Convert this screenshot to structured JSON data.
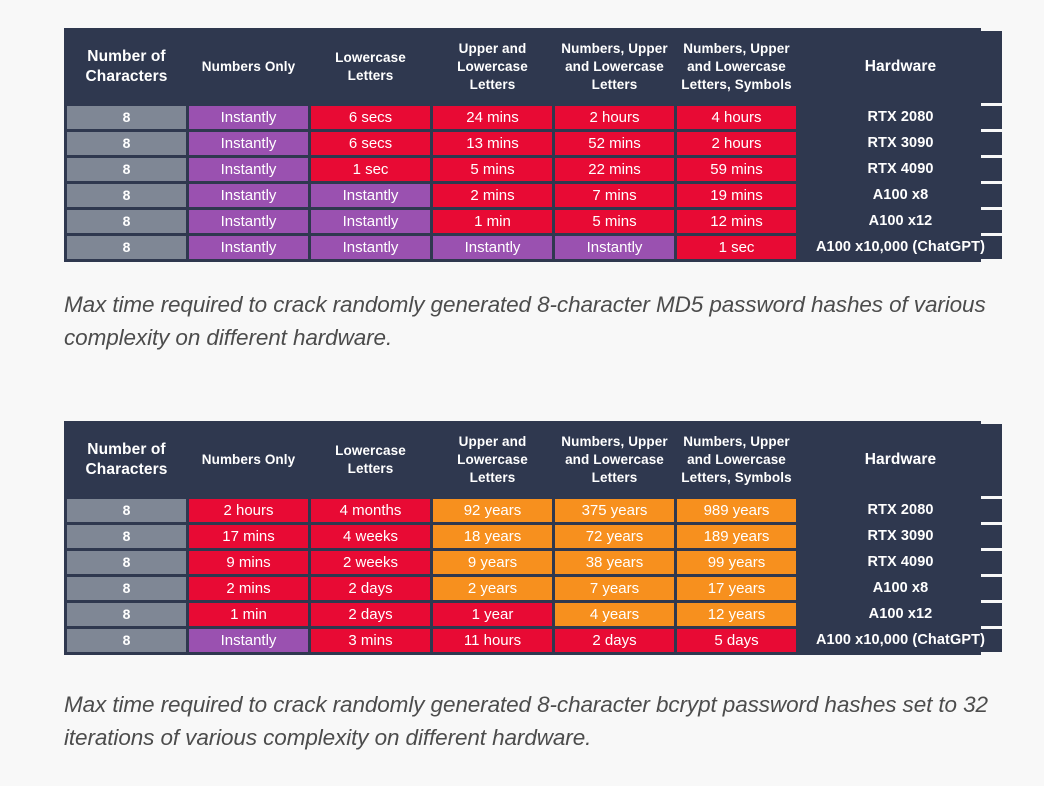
{
  "palette": {
    "page_background": "#f8f8f8",
    "table_background": "#2f384f",
    "gray": "#7f8795",
    "purple": "#9a51b0",
    "red": "#e80a34",
    "orange": "#f7901e",
    "text_light": "#ffffff",
    "caption_text": "#4c4c4c"
  },
  "tables": [
    {
      "id": "md5-table",
      "headers": [
        "Number of Characters",
        "Numbers Only",
        "Lowercase Letters",
        "Upper and Lowercase Letters",
        "Numbers, Upper and Lowercase Letters",
        "Numbers, Upper and Lowercase Letters, Symbols",
        "Hardware"
      ],
      "rows": [
        {
          "chars": "8",
          "numbers_only": "Instantly",
          "lowercase": "6 secs",
          "upper_lower": "24 mins",
          "num_upper_lower": "2 hours",
          "num_upper_lower_sym": "4 hours",
          "hardware": "RTX 2080",
          "colors": [
            "gray",
            "purple",
            "red",
            "red",
            "red",
            "red",
            "dark"
          ]
        },
        {
          "chars": "8",
          "numbers_only": "Instantly",
          "lowercase": "6 secs",
          "upper_lower": "13 mins",
          "num_upper_lower": "52 mins",
          "num_upper_lower_sym": "2 hours",
          "hardware": "RTX 3090",
          "colors": [
            "gray",
            "purple",
            "red",
            "red",
            "red",
            "red",
            "dark"
          ]
        },
        {
          "chars": "8",
          "numbers_only": "Instantly",
          "lowercase": "1 sec",
          "upper_lower": "5 mins",
          "num_upper_lower": "22 mins",
          "num_upper_lower_sym": "59 mins",
          "hardware": "RTX 4090",
          "colors": [
            "gray",
            "purple",
            "red",
            "red",
            "red",
            "red",
            "dark"
          ]
        },
        {
          "chars": "8",
          "numbers_only": "Instantly",
          "lowercase": "Instantly",
          "upper_lower": "2 mins",
          "num_upper_lower": "7 mins",
          "num_upper_lower_sym": "19 mins",
          "hardware": "A100 x8",
          "colors": [
            "gray",
            "purple",
            "purple",
            "red",
            "red",
            "red",
            "dark"
          ]
        },
        {
          "chars": "8",
          "numbers_only": "Instantly",
          "lowercase": "Instantly",
          "upper_lower": "1 min",
          "num_upper_lower": "5 mins",
          "num_upper_lower_sym": "12 mins",
          "hardware": "A100 x12",
          "colors": [
            "gray",
            "purple",
            "purple",
            "red",
            "red",
            "red",
            "dark"
          ]
        },
        {
          "chars": "8",
          "numbers_only": "Instantly",
          "lowercase": "Instantly",
          "upper_lower": "Instantly",
          "num_upper_lower": "Instantly",
          "num_upper_lower_sym": "1 sec",
          "hardware": "A100 x10,000 (ChatGPT)",
          "colors": [
            "gray",
            "purple",
            "purple",
            "purple",
            "purple",
            "red",
            "dark"
          ]
        }
      ],
      "caption": "Max time required to crack randomly generated 8-character MD5 password hashes of various complexity on different hardware."
    },
    {
      "id": "bcrypt-table",
      "headers": [
        "Number of Characters",
        "Numbers Only",
        "Lowercase Letters",
        "Upper and Lowercase Letters",
        "Numbers, Upper and Lowercase Letters",
        "Numbers, Upper and Lowercase Letters, Symbols",
        "Hardware"
      ],
      "rows": [
        {
          "chars": "8",
          "numbers_only": "2 hours",
          "lowercase": "4 months",
          "upper_lower": "92 years",
          "num_upper_lower": "375 years",
          "num_upper_lower_sym": "989 years",
          "hardware": "RTX 2080",
          "colors": [
            "gray",
            "red",
            "red",
            "orange",
            "orange",
            "orange",
            "dark"
          ]
        },
        {
          "chars": "8",
          "numbers_only": "17 mins",
          "lowercase": "4 weeks",
          "upper_lower": "18 years",
          "num_upper_lower": "72 years",
          "num_upper_lower_sym": "189 years",
          "hardware": "RTX 3090",
          "colors": [
            "gray",
            "red",
            "red",
            "orange",
            "orange",
            "orange",
            "dark"
          ]
        },
        {
          "chars": "8",
          "numbers_only": "9 mins",
          "lowercase": "2 weeks",
          "upper_lower": "9 years",
          "num_upper_lower": "38 years",
          "num_upper_lower_sym": "99 years",
          "hardware": "RTX 4090",
          "colors": [
            "gray",
            "red",
            "red",
            "orange",
            "orange",
            "orange",
            "dark"
          ]
        },
        {
          "chars": "8",
          "numbers_only": "2 mins",
          "lowercase": "2 days",
          "upper_lower": "2 years",
          "num_upper_lower": "7 years",
          "num_upper_lower_sym": "17 years",
          "hardware": "A100 x8",
          "colors": [
            "gray",
            "red",
            "red",
            "orange",
            "orange",
            "orange",
            "dark"
          ]
        },
        {
          "chars": "8",
          "numbers_only": "1 min",
          "lowercase": "2 days",
          "upper_lower": "1 year",
          "num_upper_lower": "4 years",
          "num_upper_lower_sym": "12 years",
          "hardware": "A100 x12",
          "colors": [
            "gray",
            "red",
            "red",
            "red",
            "orange",
            "orange",
            "dark"
          ]
        },
        {
          "chars": "8",
          "numbers_only": "Instantly",
          "lowercase": "3 mins",
          "upper_lower": "11 hours",
          "num_upper_lower": "2 days",
          "num_upper_lower_sym": "5 days",
          "hardware": "A100 x10,000 (ChatGPT)",
          "colors": [
            "gray",
            "purple",
            "red",
            "red",
            "red",
            "red",
            "dark"
          ]
        }
      ],
      "caption": "Max time required to crack randomly generated 8-character bcrypt password hashes set to 32 iterations of various complexity on different hardware."
    }
  ]
}
